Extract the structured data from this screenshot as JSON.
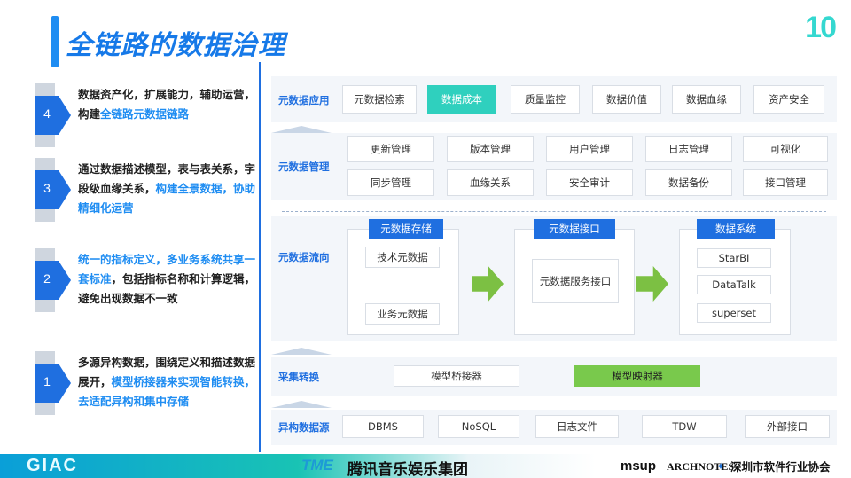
{
  "title": "全链路的数据治理",
  "logo_text": "10",
  "steps": [
    {
      "num": "4",
      "pre": "数据资产化，扩展能力，辅助运营，构建",
      "hl": "全链路元数据链路",
      "post": ""
    },
    {
      "num": "3",
      "pre": "通过数据描述模型，表与表关系，字段级血缘关系，",
      "hl": "构建全景数据，协助精细化运营",
      "post": ""
    },
    {
      "num": "2",
      "hl1": "统一的指标定义，多业务系统共享一套标准",
      "mid": "，包括指标名称和计算逻辑，避免出现数据不一致"
    },
    {
      "num": "1",
      "pre": "多源异构数据，围绕定义和描述数据展开，",
      "hl": "模型桥接器来实现智能转换，去适配异构和集中存储",
      "post": ""
    }
  ],
  "app_layer": {
    "label": "元数据应用",
    "items": [
      "元数据检索",
      "数据成本",
      "质量监控",
      "数据价值",
      "数据血缘",
      "资产安全"
    ]
  },
  "mgmt_layer": {
    "label": "元数据管理",
    "row1": [
      "更新管理",
      "版本管理",
      "用户管理",
      "日志管理",
      "可视化"
    ],
    "row2": [
      "同步管理",
      "血缘关系",
      "安全审计",
      "数据备份",
      "接口管理"
    ]
  },
  "flow_layer": {
    "label": "元数据流向",
    "storage": {
      "title": "元数据存储",
      "items": [
        "技术元数据",
        "业务元数据"
      ]
    },
    "interface": {
      "title": "元数据接口",
      "items": [
        "元数据服务接口"
      ]
    },
    "systems": {
      "title": "数据系统",
      "items": [
        "StarBI",
        "DataTalk",
        "superset"
      ]
    }
  },
  "collect_layer": {
    "label": "采集转换",
    "items": [
      "模型桥接器",
      "模型映射器"
    ]
  },
  "source_layer": {
    "label": "异构数据源",
    "items": [
      "DBMS",
      "NoSQL",
      "日志文件",
      "TDW",
      "外部接口"
    ]
  },
  "footer": {
    "giac": "GIAC",
    "tme_logo": "TME",
    "tme": "腾讯音乐娱乐集团",
    "msup": "msup",
    "arch": "ARCHNOTES",
    "szsia": "深圳市软件行业协会"
  }
}
